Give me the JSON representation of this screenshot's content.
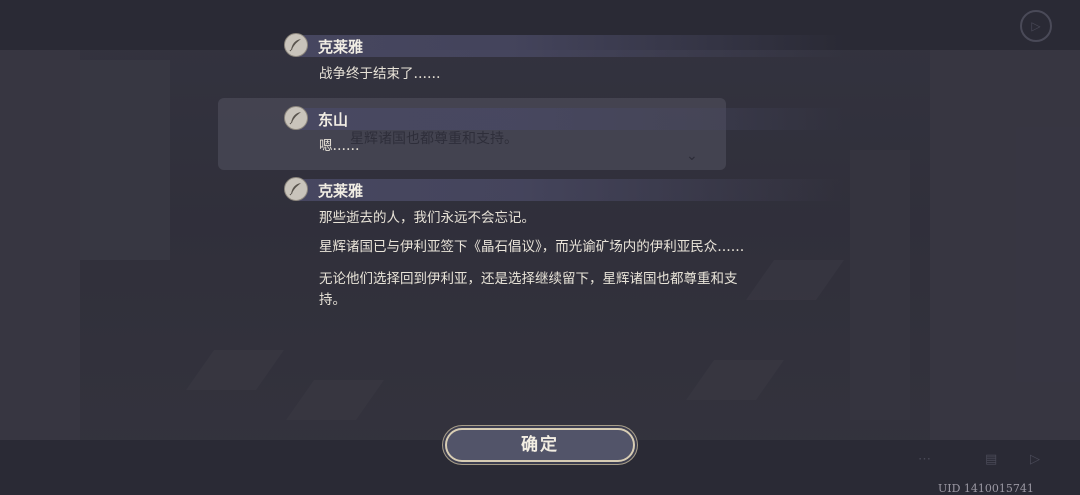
{
  "dialogue_log": [
    {
      "speaker": "克莱雅",
      "lines": [
        "战争终于结束了……"
      ]
    },
    {
      "speaker": "东山",
      "lines": [
        "嗯……"
      ]
    },
    {
      "speaker": "克莱雅",
      "lines": [
        "那些逝去的人，我们永远不会忘记。",
        "星辉诸国已与伊利亚签下《晶石倡议》，而光谕矿场内的伊利亚民众……",
        "无论他们选择回到伊利亚，还是选择继续留下，星辉诸国也都尊重和支持。"
      ]
    }
  ],
  "background_dialog_text": "星辉诸国也都尊重和支持。",
  "confirm_label": "确定",
  "uid_label": "UID 1410015741",
  "icons": {
    "speaker": "quill-icon",
    "background_chevron": "chevron-down-icon",
    "top_right": "circle-play-icon"
  }
}
